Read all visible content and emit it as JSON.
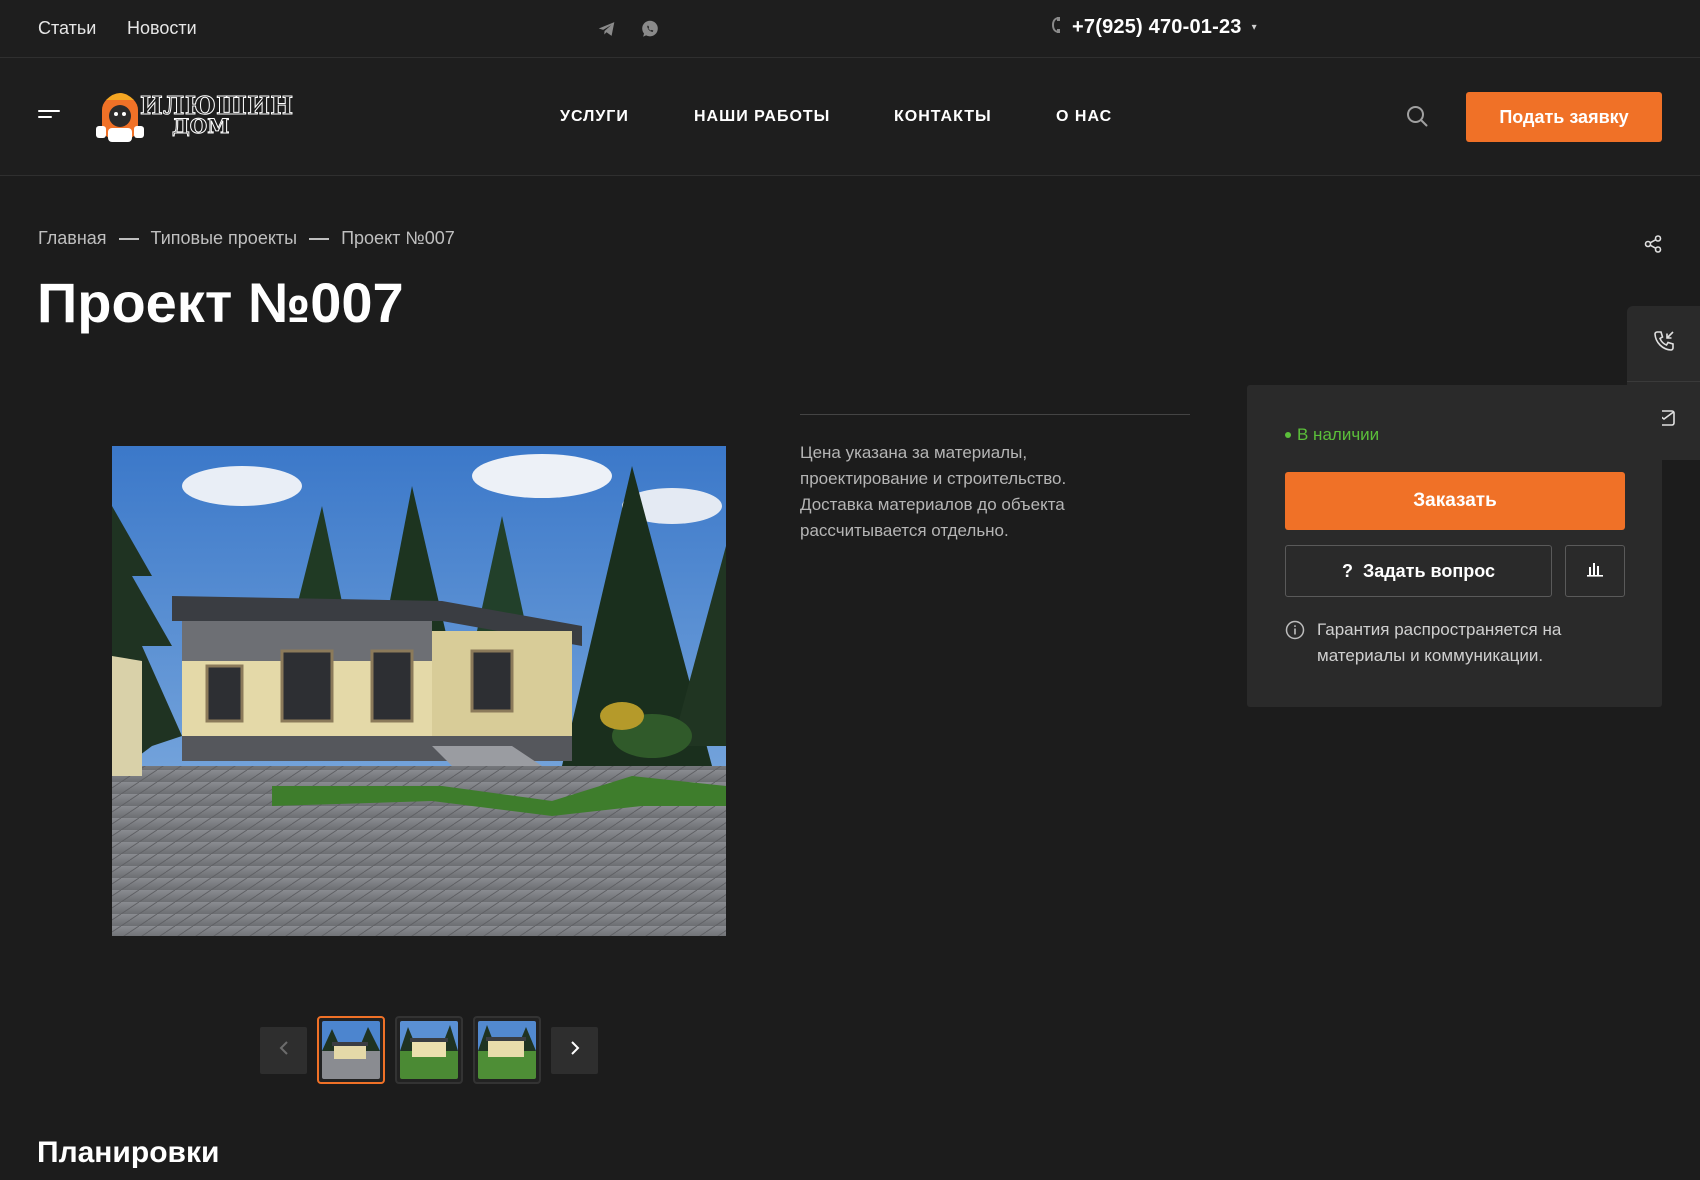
{
  "topbar": {
    "links": [
      "Статьи",
      "Новости"
    ],
    "social": [
      "telegram-icon",
      "whatsapp-icon"
    ],
    "phone": "+7(925) 470-01-23",
    "phone_caret": "▾"
  },
  "header": {
    "logo_line1": "ИЛЮШИН",
    "logo_line2": "ДОМ",
    "nav": [
      "УСЛУГИ",
      "НАШИ РАБОТЫ",
      "КОНТАКТЫ",
      "О НАС"
    ],
    "cta_label": "Подать заявку"
  },
  "breadcrumb": [
    "Главная",
    "Типовые проекты",
    "Проект №007"
  ],
  "page_title": "Проект №007",
  "description": "Цена указана за материалы, проектирование и строительство. Доставка материалов до объекта рассчитывается отдельно.",
  "order_card": {
    "stock": "В наличии",
    "order_label": "Заказать",
    "ask_icon": "?",
    "ask_label": "Задать вопрос",
    "guarantee": "Гарантия распространяется на материалы и коммуникации."
  },
  "gallery": {
    "thumbnail_count": 3,
    "active_index": 0
  },
  "section_title": "Планировки",
  "colors": {
    "accent": "#f07127",
    "background": "#1c1c1c",
    "card": "#2a2a2a",
    "stock": "#5bbf3a"
  }
}
